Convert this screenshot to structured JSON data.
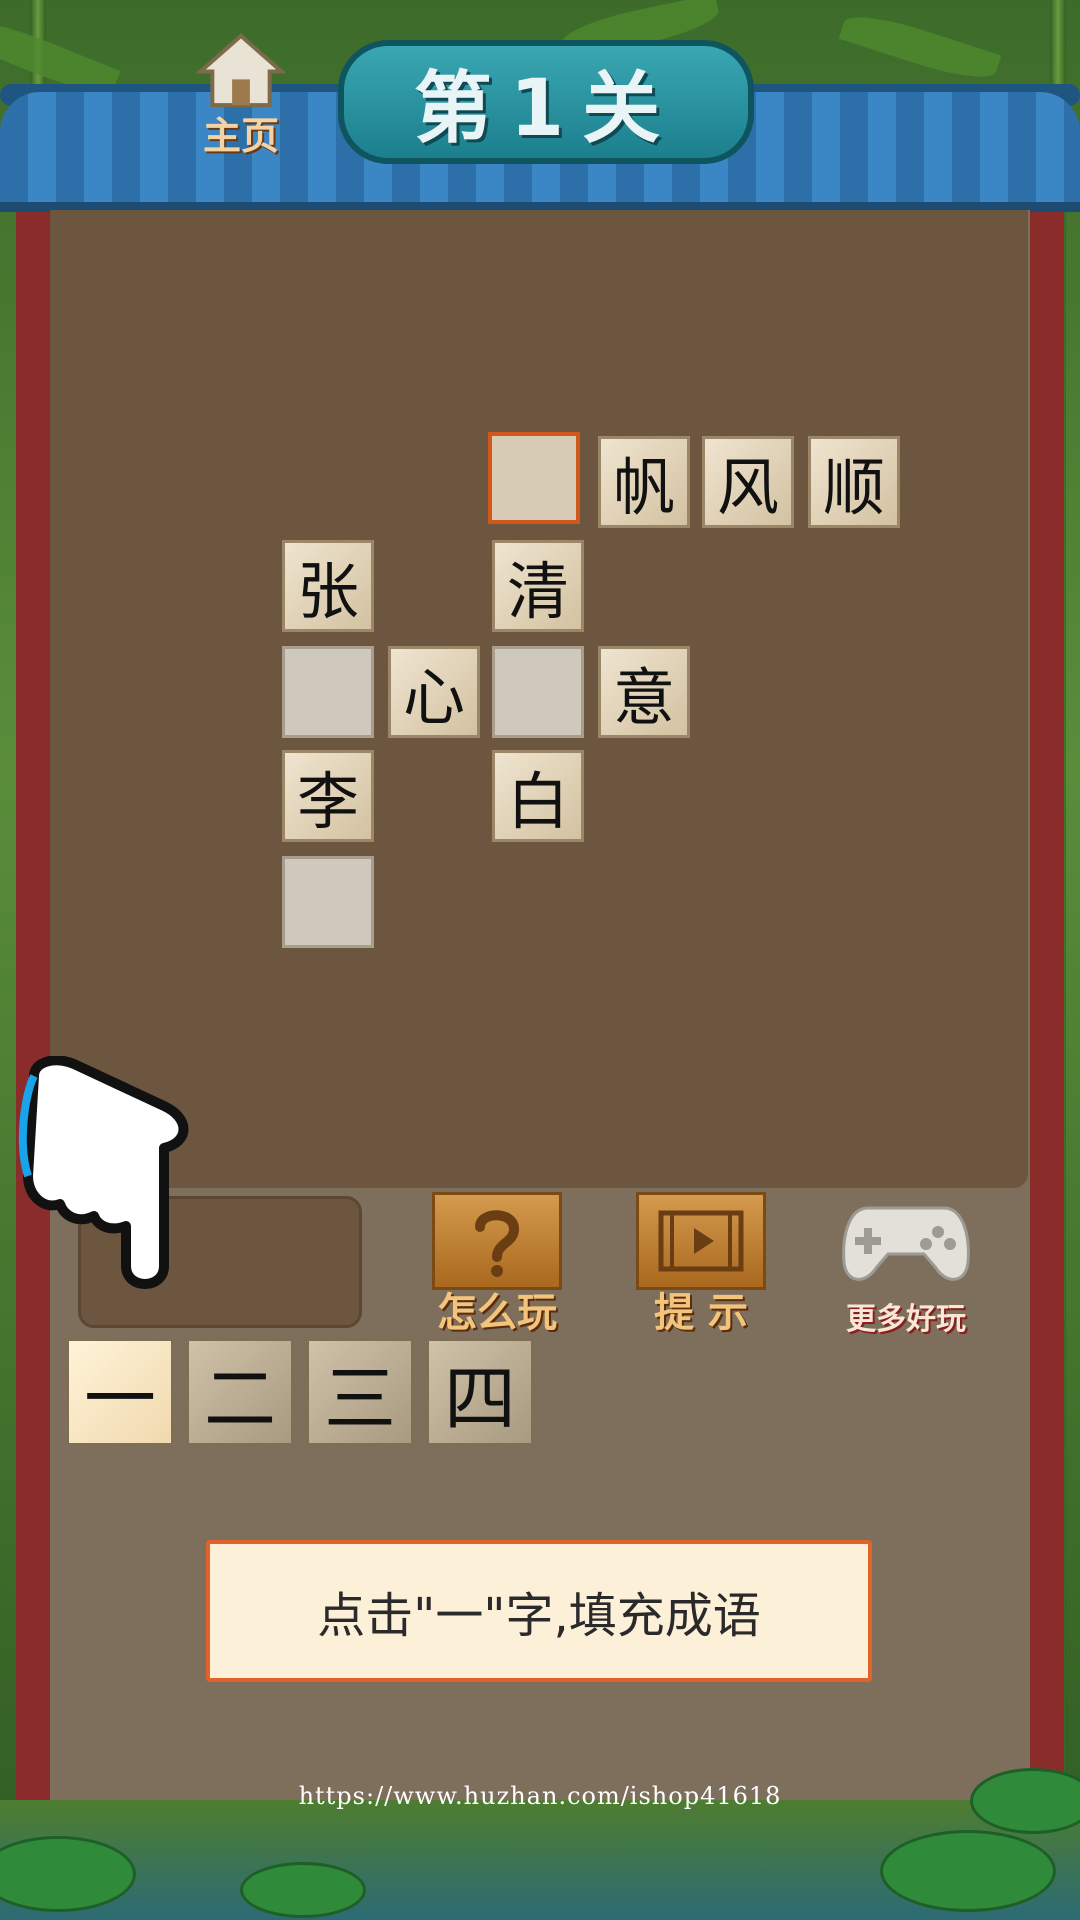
{
  "header": {
    "home_label": "主页",
    "level_title": "第1关"
  },
  "puzzle": {
    "cells": [
      {
        "char": "",
        "state": "active"
      },
      {
        "char": "帆",
        "state": "filled"
      },
      {
        "char": "风",
        "state": "filled"
      },
      {
        "char": "顺",
        "state": "filled"
      },
      {
        "char": "张",
        "state": "filled"
      },
      {
        "char": "清",
        "state": "filled"
      },
      {
        "char": "",
        "state": "empty"
      },
      {
        "char": "心",
        "state": "filled"
      },
      {
        "char": "",
        "state": "empty"
      },
      {
        "char": "意",
        "state": "filled"
      },
      {
        "char": "李",
        "state": "filled"
      },
      {
        "char": "白",
        "state": "filled"
      },
      {
        "char": "",
        "state": "empty"
      }
    ]
  },
  "tools": {
    "how_to_play_label": "怎么玩",
    "hint_label": "提 示",
    "more_games_label": "更多好玩"
  },
  "options": [
    "一",
    "二",
    "三",
    "四"
  ],
  "instruction": "点击\"一\"字,填充成语",
  "watermark": "https://www.huzhan.com/ishop41618"
}
